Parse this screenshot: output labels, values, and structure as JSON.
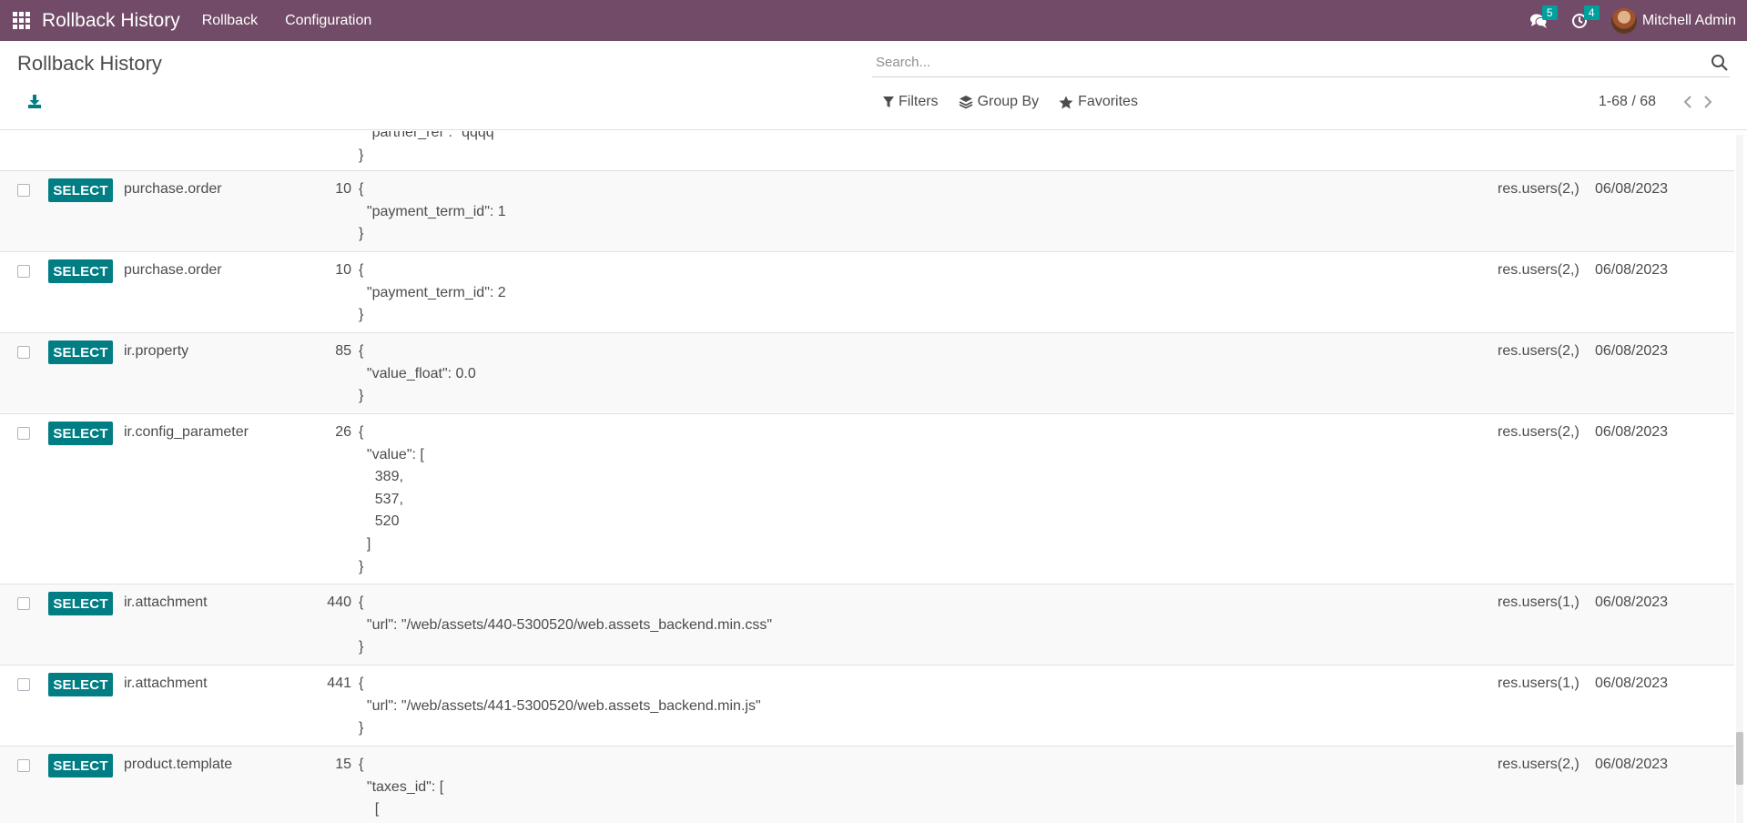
{
  "navbar": {
    "app_title": "Rollback History",
    "menus": [
      "Rollback",
      "Configuration"
    ],
    "messages_count": "5",
    "activities_count": "4",
    "user_name": "Mitchell Admin"
  },
  "control_panel": {
    "title": "Rollback History",
    "search_placeholder": "Search...",
    "filters_label": "Filters",
    "group_by_label": "Group By",
    "favorites_label": "Favorites",
    "pager": "1-68 / 68"
  },
  "list": {
    "select_label": "SELECT",
    "partial_top": "  \"partner_ref\": \"qqqq\"\n}",
    "rows": [
      {
        "model": "purchase.order",
        "res_id": "10",
        "values": "{\n  \"payment_term_id\": 1\n}",
        "user": "res.users(2,)",
        "date": "06/08/2023"
      },
      {
        "model": "purchase.order",
        "res_id": "10",
        "values": "{\n  \"payment_term_id\": 2\n}",
        "user": "res.users(2,)",
        "date": "06/08/2023"
      },
      {
        "model": "ir.property",
        "res_id": "85",
        "values": "{\n  \"value_float\": 0.0\n}",
        "user": "res.users(2,)",
        "date": "06/08/2023"
      },
      {
        "model": "ir.config_parameter",
        "res_id": "26",
        "values": "{\n  \"value\": [\n    389,\n    537,\n    520\n  ]\n}",
        "user": "res.users(2,)",
        "date": "06/08/2023"
      },
      {
        "model": "ir.attachment",
        "res_id": "440",
        "values": "{\n  \"url\": \"/web/assets/440-5300520/web.assets_backend.min.css\"\n}",
        "user": "res.users(1,)",
        "date": "06/08/2023"
      },
      {
        "model": "ir.attachment",
        "res_id": "441",
        "values": "{\n  \"url\": \"/web/assets/441-5300520/web.assets_backend.min.js\"\n}",
        "user": "res.users(1,)",
        "date": "06/08/2023"
      },
      {
        "model": "product.template",
        "res_id": "15",
        "values": "{\n  \"taxes_id\": [\n    [",
        "user": "res.users(2,)",
        "date": "06/08/2023"
      }
    ]
  }
}
